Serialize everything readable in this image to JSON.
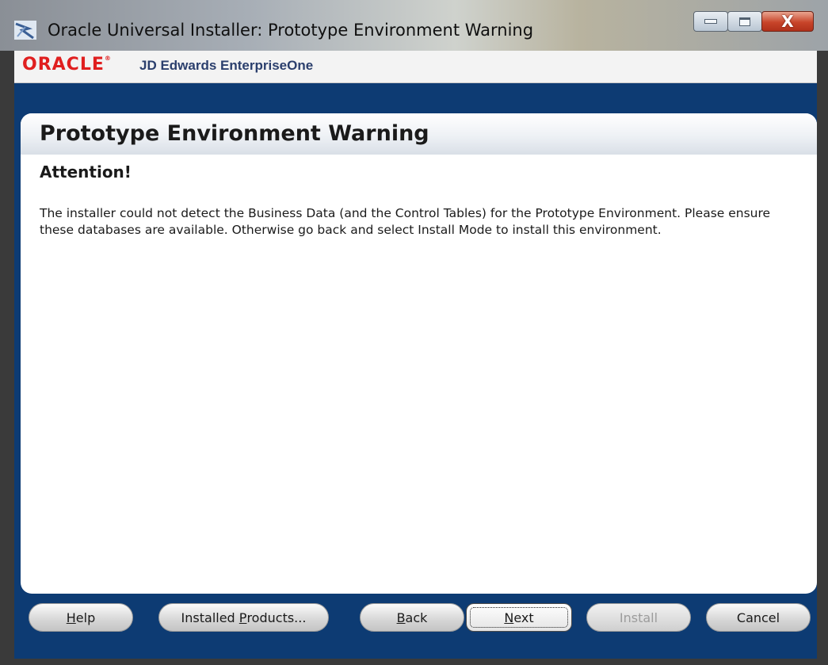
{
  "window": {
    "title": "Oracle Universal Installer: Prototype Environment Warning",
    "controls": {
      "minimize_icon": "minimize-icon",
      "maximize_icon": "maximize-icon",
      "close_icon": "close-icon"
    }
  },
  "brand": {
    "logo_text": "ORACLE",
    "product": "JD Edwards EnterpriseOne"
  },
  "page": {
    "title": "Prototype Environment Warning",
    "subtitle": "Attention!",
    "message": "The installer could not detect the Business Data (and the Control Tables) for the Prototype Environment. Please ensure these databases are available. Otherwise go back and select Install Mode to install this environment."
  },
  "buttons": {
    "help": {
      "label_pre": "",
      "mnemonic": "H",
      "label_post": "elp"
    },
    "installed_products": {
      "label_pre": "Installed ",
      "mnemonic": "P",
      "label_post": "roducts..."
    },
    "back": {
      "label_pre": "",
      "mnemonic": "B",
      "label_post": "ack"
    },
    "next": {
      "label_pre": "",
      "mnemonic": "N",
      "label_post": "ext"
    },
    "install": {
      "label": "Install"
    },
    "cancel": {
      "label": "Cancel"
    }
  },
  "colors": {
    "frame_blue": "#0d3b73",
    "oracle_red": "#e01f1f",
    "product_text": "#2b3f6d"
  }
}
